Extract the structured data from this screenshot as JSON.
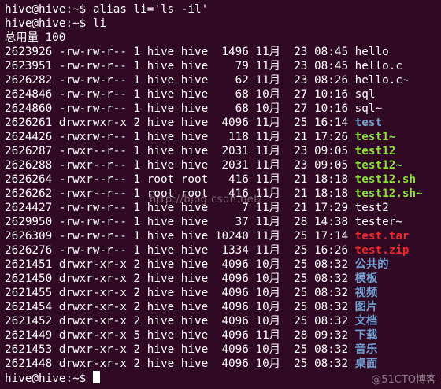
{
  "terminal": {
    "background": "#300a24",
    "colors": {
      "directory": "#729fcf",
      "executable": "#8ae234",
      "archive": "#ef2929",
      "text": "#ffffff"
    },
    "lines": [
      {
        "text": "hive@hive:~$ alias li='ls -il'",
        "kind": "plain"
      },
      {
        "text": "hive@hive:~$ li",
        "kind": "plain"
      },
      {
        "text": "总用量 100",
        "kind": "plain"
      },
      {
        "prefix": "2623926 -rw-rw-r-- 1 hive hive  1496 11月  23 08:45 ",
        "name": "hello",
        "kind": "plain"
      },
      {
        "prefix": "2623951 -rw-rw-r-- 1 hive hive    79 11月  23 08:45 ",
        "name": "hello.c",
        "kind": "plain"
      },
      {
        "prefix": "2626282 -rw-rw-r-- 1 hive hive    62 11月  23 08:26 ",
        "name": "hello.c~",
        "kind": "plain"
      },
      {
        "prefix": "2624846 -rw-rw-r-- 1 hive hive    68 10月  27 10:16 ",
        "name": "sql",
        "kind": "plain"
      },
      {
        "prefix": "2624860 -rw-rw-r-- 1 hive hive    68 10月  27 10:16 ",
        "name": "sql~",
        "kind": "plain"
      },
      {
        "prefix": "2626261 drwxrwxr-x 2 hive hive  4096 11月  25 16:14 ",
        "name": "test",
        "kind": "dir"
      },
      {
        "prefix": "2624426 -rwxrw-r-- 1 hive hive   118 11月  21 17:26 ",
        "name": "test1~",
        "kind": "exe"
      },
      {
        "prefix": "2626287 -rwxr--r-- 1 hive hive  2031 11月  23 09:05 ",
        "name": "test12",
        "kind": "exe"
      },
      {
        "prefix": "2626288 -rwxr--r-- 1 hive hive  2031 11月  23 09:05 ",
        "name": "test12~",
        "kind": "exe"
      },
      {
        "prefix": "2626264 -rwxr--r-- 1 root root   416 11月  21 18:18 ",
        "name": "test12.sh",
        "kind": "exe"
      },
      {
        "prefix": "2626262 -rwxr--r-- 1 root root   416 11月  21 18:18 ",
        "name": "test12.sh~",
        "kind": "exe"
      },
      {
        "prefix": "2624427 -rw-rw-r-- 1 hive hive     7 11月  21 17:29 ",
        "name": "test2",
        "kind": "plain"
      },
      {
        "prefix": "2629950 -rw-rw-r-- 1 hive hive    37 11月  28 14:38 ",
        "name": "tester~",
        "kind": "plain"
      },
      {
        "prefix": "2626309 -rw-rw-r-- 1 hive hive 10240 11月  25 17:14 ",
        "name": "test.tar",
        "kind": "arc"
      },
      {
        "prefix": "2626276 -rw-rw-r-- 1 hive hive  1334 11月  25 16:26 ",
        "name": "test.zip",
        "kind": "arc"
      },
      {
        "prefix": "2621451 drwxr-xr-x 2 hive hive  4096 10月  25 08:32 ",
        "name": "公共的",
        "kind": "dir"
      },
      {
        "prefix": "2621450 drwxr-xr-x 2 hive hive  4096 10月  25 08:32 ",
        "name": "模板",
        "kind": "dir"
      },
      {
        "prefix": "2621455 drwxr-xr-x 2 hive hive  4096 10月  25 08:32 ",
        "name": "视频",
        "kind": "dir"
      },
      {
        "prefix": "2621454 drwxr-xr-x 2 hive hive  4096 10月  25 08:32 ",
        "name": "图片",
        "kind": "dir"
      },
      {
        "prefix": "2621452 drwxr-xr-x 2 hive hive  4096 10月  25 08:32 ",
        "name": "文档",
        "kind": "dir"
      },
      {
        "prefix": "2621449 drwxr-xr-x 5 hive hive  4096 11月  28 09:32 ",
        "name": "下载",
        "kind": "dir"
      },
      {
        "prefix": "2621453 drwxr-xr-x 2 hive hive  4096 10月  25 08:32 ",
        "name": "音乐",
        "kind": "dir"
      },
      {
        "prefix": "2621448 drwxr-xr-x 2 hive hive  4096 10月  25 08:32 ",
        "name": "桌面",
        "kind": "dir"
      }
    ],
    "prompt": "hive@hive:~$ "
  },
  "watermark": "http://blog.csdn.net/",
  "corner_mark": "@51CTO博客"
}
